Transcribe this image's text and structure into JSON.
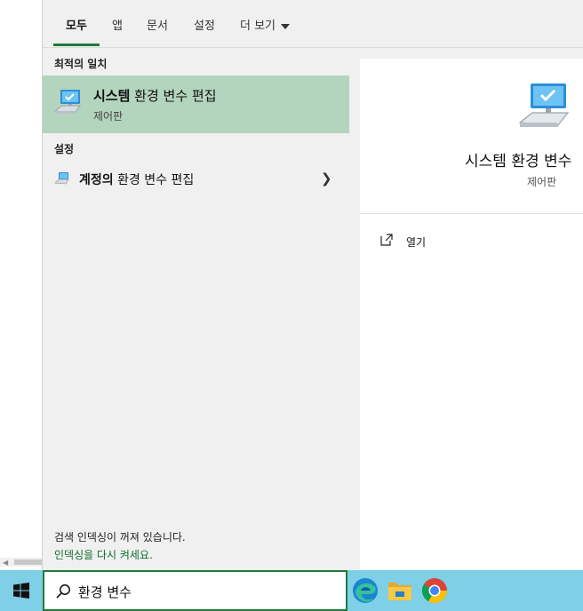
{
  "tabs": [
    {
      "label": "모두",
      "active": true
    },
    {
      "label": "앱",
      "active": false
    },
    {
      "label": "문서",
      "active": false
    },
    {
      "label": "설정",
      "active": false
    },
    {
      "label": "더 보기",
      "active": false
    }
  ],
  "results": {
    "best_match_heading": "최적의 일치",
    "best_match": {
      "title_bold": "시스템",
      "title_rest": " 환경 변수 편집",
      "subtitle": "제어판",
      "icon": "system-computer-icon"
    },
    "settings_heading": "설정",
    "setting_item": {
      "title_bold": "계정의",
      "title_rest": " 환경 변수 편집",
      "icon": "system-computer-icon"
    },
    "index_notice": {
      "message": "검색 인덱싱이 꺼져 있습니다.",
      "link": "인덱싱을 다시 켜세요."
    }
  },
  "preview": {
    "title": "시스템 환경 변수",
    "subtitle": "제어판",
    "actions": [
      {
        "label": "열기",
        "icon": "open-external-icon"
      }
    ]
  },
  "taskbar": {
    "search_value": "환경 변수",
    "apps": [
      "edge-icon",
      "file-explorer-icon",
      "chrome-icon"
    ]
  },
  "colors": {
    "accent": "#1f7a3a",
    "selected_bg": "#b3d4bd",
    "taskbar_bg": "#7fcfe7",
    "link": "#0e6e2b"
  }
}
